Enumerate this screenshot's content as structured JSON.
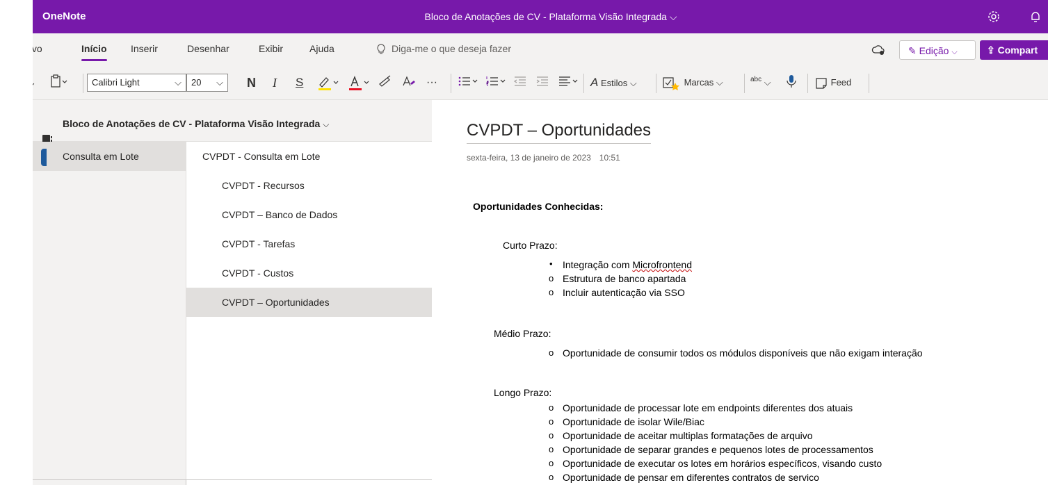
{
  "app": {
    "name": "OneNote",
    "document_title": "Bloco de Anotações de CV - Plataforma Visão Integrada ⌵"
  },
  "ribbon": {
    "tabs": [
      "uivo",
      "Início",
      "Inserir",
      "Desenhar",
      "Exibir",
      "Ajuda"
    ],
    "active_tab": "Início",
    "search_placeholder": "Diga-me o que deseja fazer",
    "edit_button": "Edição",
    "share_button": "Compart"
  },
  "toolbar": {
    "font_name": "Calibri Light",
    "font_size": "20",
    "bold": "N",
    "italic": "I",
    "underline": "S",
    "more": "···",
    "styles": "Estilos",
    "tags": "Marcas",
    "spell": "abc",
    "feed": "Feed",
    "colors": {
      "highlight": "#ffe100",
      "font": "#e81123",
      "accent": "#7719aa"
    }
  },
  "notebook": {
    "title": "Bloco de Anotações de CV - Plataforma Visão Integrada",
    "sections": [
      {
        "label": "Consulta em Lote",
        "selected": true,
        "color": "#1e5a9c"
      }
    ],
    "pages": [
      {
        "label": "CVPDT - Consulta em Lote",
        "level": 0
      },
      {
        "label": "CVPDT - Recursos",
        "level": 1
      },
      {
        "label": "CVPDT – Banco de Dados",
        "level": 1
      },
      {
        "label": "CVPDT - Tarefas",
        "level": 1
      },
      {
        "label": "CVPDT - Custos",
        "level": 1
      },
      {
        "label": "CVPDT – Oportunidades",
        "level": 1,
        "selected": true
      }
    ]
  },
  "page": {
    "title": "CVPDT – Oportunidades",
    "date": "sexta-feira, 13 de janeiro de 2023",
    "time": "10:51",
    "heading": "Oportunidades Conhecidas:",
    "groups": [
      {
        "label": "Curto Prazo:",
        "items": [
          {
            "bullet": "•",
            "text": "Integração com Microfrontend"
          },
          {
            "bullet": "o",
            "text": "Estrutura de banco apartada"
          },
          {
            "bullet": "o",
            "text": "Incluir autenticação via SSO"
          }
        ]
      },
      {
        "label": "Médio Prazo:",
        "items": [
          {
            "bullet": "o",
            "text": "Oportunidade de consumir todos os módulos disponíveis que não exigam interação"
          }
        ]
      },
      {
        "label": "Longo Prazo:",
        "items": [
          {
            "bullet": "o",
            "text": "Oportunidade de processar lote em endpoints diferentes dos atuais"
          },
          {
            "bullet": "o",
            "text": "Oportunidade de isolar Wile/Biac"
          },
          {
            "bullet": "o",
            "text": "Oportunidade de aceitar multiplas formatações de arquivo"
          },
          {
            "bullet": "o",
            "text": "Oportunidade de separar grandes e pequenos lotes de processamentos"
          },
          {
            "bullet": "o",
            "text": "Oportunidade de executar os lotes em horários específicos, visando custo"
          },
          {
            "bullet": "o",
            "text": "Oportunidade de pensar em diferentes contratos de servico"
          }
        ]
      }
    ]
  }
}
